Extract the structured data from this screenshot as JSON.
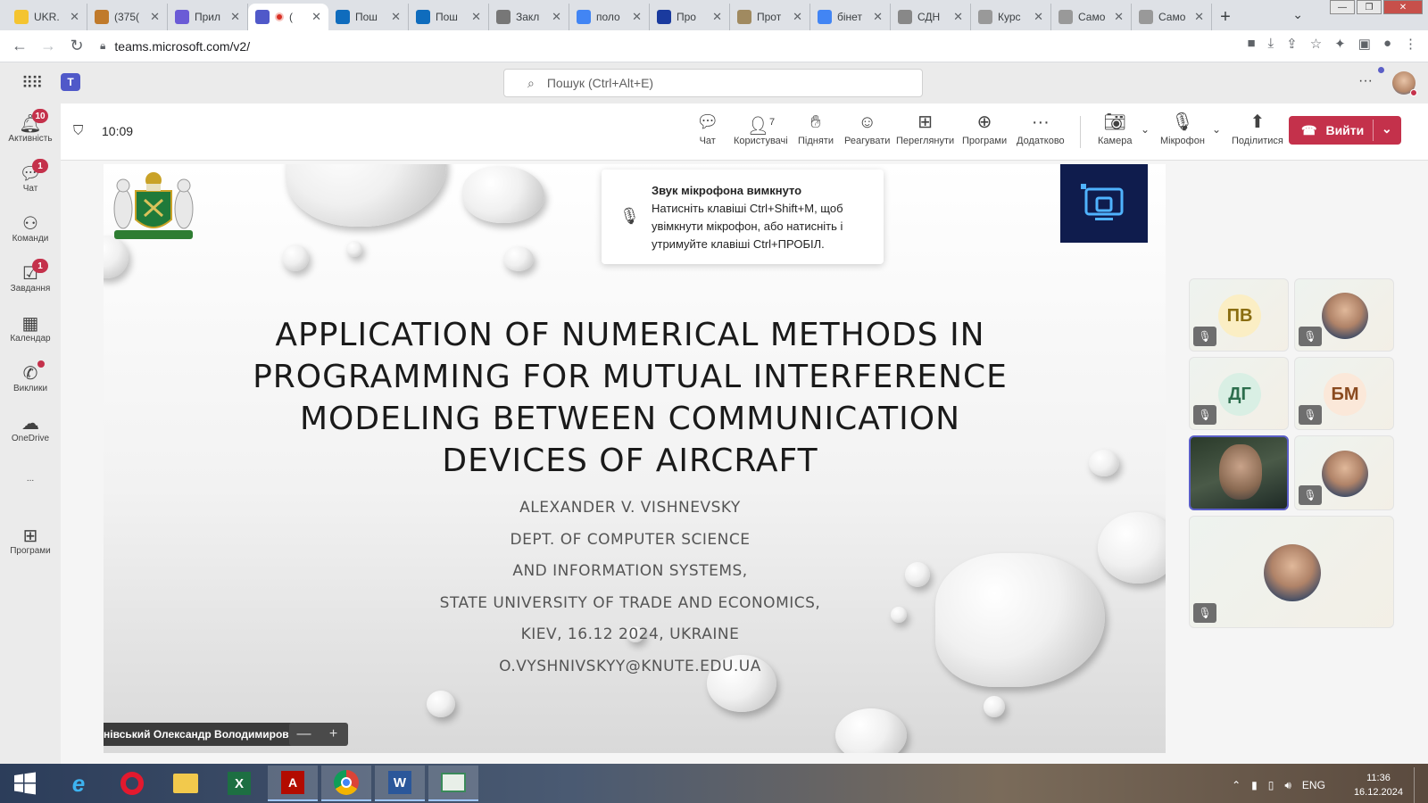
{
  "browser": {
    "tabs": [
      {
        "label": "UKR.",
        "color": "#f4c430"
      },
      {
        "label": "(375(",
        "color": "#c07a2b"
      },
      {
        "label": "Прил",
        "color": "#6b5bd6"
      },
      {
        "label": "(",
        "color": "#5059c9",
        "active": true
      },
      {
        "label": "Пош",
        "color": "#0f6cbd"
      },
      {
        "label": "Пош",
        "color": "#0f6cbd"
      },
      {
        "label": "Закл",
        "color": "#777777"
      },
      {
        "label": "поло",
        "color": "#4285f4"
      },
      {
        "label": "Про",
        "color": "#1a3a9e"
      },
      {
        "label": "Прот",
        "color": "#a08a60"
      },
      {
        "label": "бінет",
        "color": "#4285f4"
      },
      {
        "label": "СДН",
        "color": "#888888"
      },
      {
        "label": "Курс",
        "color": "#999999"
      },
      {
        "label": "Само",
        "color": "#999999"
      },
      {
        "label": "Само",
        "color": "#999999"
      }
    ],
    "new_tab": "+",
    "url": "teams.microsoft.com/v2/"
  },
  "teams": {
    "search_placeholder": "Пошук (Ctrl+Alt+E)",
    "rail": [
      {
        "label": "Активність",
        "icon": "bell-icon",
        "badge": "10"
      },
      {
        "label": "Чат",
        "icon": "chat-icon",
        "badge": "1"
      },
      {
        "label": "Команди",
        "icon": "teams-icon",
        "badge": ""
      },
      {
        "label": "Завдання",
        "icon": "tasks-icon",
        "badge": "1"
      },
      {
        "label": "Календар",
        "icon": "calendar-icon",
        "badge": ""
      },
      {
        "label": "Виклики",
        "icon": "phone-icon",
        "badge": "dot"
      },
      {
        "label": "OneDrive",
        "icon": "cloud-icon",
        "badge": ""
      },
      {
        "label": "...",
        "icon": "more-icon",
        "badge": ""
      },
      {
        "label": "Програми",
        "icon": "apps-icon",
        "badge": ""
      }
    ]
  },
  "meeting": {
    "timer": "10:09",
    "toolbar": {
      "chat": "Чат",
      "people": "Користувачі",
      "people_count": "7",
      "raise": "Підняти",
      "react": "Реагувати",
      "view": "Переглянути",
      "apps": "Програми",
      "more": "Додатково",
      "camera": "Камера",
      "mic": "Мікрофон",
      "share": "Поділитися",
      "leave": "Вийти"
    },
    "toast": {
      "title": "Звук мікрофона вимкнуто",
      "body": "Натисніть клавіші Ctrl+Shift+M, щоб увімкнути мікрофон, або натисніть і утримуйте клавіші Ctrl+ПРОБІЛ."
    },
    "slide": {
      "title_lines": [
        "APPLICATION OF NUMERICAL METHODS IN",
        "PROGRAMMING FOR MUTUAL INTERFERENCE",
        "MODELING BETWEEN COMMUNICATION",
        "DEVICES OF AIRCRAFT"
      ],
      "sub_lines": [
        "ALEXANDER V. VISHNEVSKY",
        "DEPT. OF COMPUTER SCIENCE",
        "AND INFORMATION SYSTEMS,",
        "STATE UNIVERSITY OF TRADE AND ECONOMICS,",
        "KIEV, 16.12 2024, UKRAINE",
        "O.VYSHNIVSKYY@KNUTE.EDU.UA"
      ]
    },
    "presenter_name": "Вишнівський Олександр Володимирович",
    "zoom_minus": "—",
    "zoom_plus": "+",
    "participants": [
      {
        "initials": "ПВ",
        "bg": "#fbeec4",
        "fg": "#8a6d10"
      },
      {
        "initials": "",
        "photo": true
      },
      {
        "initials": "ДГ",
        "bg": "#d9efe4",
        "fg": "#2c6e4d"
      },
      {
        "initials": "БМ",
        "bg": "#fbe8d9",
        "fg": "#8a4a1f"
      },
      {
        "initials": "",
        "video": true
      },
      {
        "initials": "",
        "photo": true
      },
      {
        "initials": "",
        "photo": true
      }
    ]
  },
  "taskbar": {
    "lang": "ENG",
    "time": "11:36",
    "date": "16.12.2024"
  }
}
